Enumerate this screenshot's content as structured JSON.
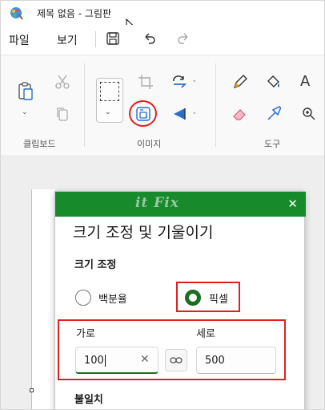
{
  "window": {
    "title": "제목 없음 - 그림판"
  },
  "menu": {
    "file": "파일",
    "view": "보기"
  },
  "ribbon": {
    "groups": {
      "clipboard": "클립보드",
      "image": "이미지",
      "tools": "도구"
    },
    "text_tool": "A"
  },
  "dialog": {
    "watermark": "it Fix",
    "title": "크기 조정 및 기울이기",
    "resize_section": "크기 조정",
    "percent_label": "백분율",
    "pixel_label": "픽셀",
    "horizontal_label": "가로",
    "vertical_label": "세로",
    "horizontal_value": "100",
    "vertical_value": "500",
    "skew_section": "불일치"
  },
  "colors": {
    "dialog_header": "#178a2c",
    "accent": "#1b6d1f",
    "highlight": "#e02020"
  }
}
